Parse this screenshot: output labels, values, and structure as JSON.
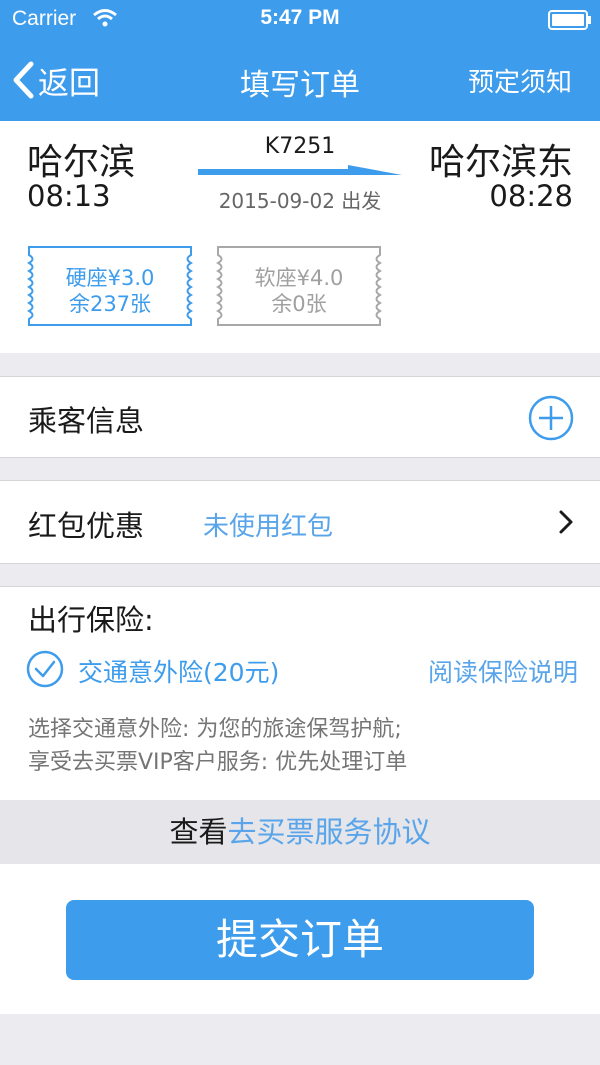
{
  "status_bar": {
    "carrier": "Carrier",
    "time": "5:47 PM"
  },
  "nav": {
    "back_label": "返回",
    "title": "填写订单",
    "right_label": "预定须知"
  },
  "train": {
    "from_station": "哈尔滨",
    "from_time": "08:13",
    "to_station": "哈尔滨东",
    "to_time": "08:28",
    "number": "K7251",
    "depart_text": "2015-09-02 出发"
  },
  "seats": [
    {
      "type": "硬座¥3.0",
      "remaining": "余237张",
      "selected": true
    },
    {
      "type": "软座¥4.0",
      "remaining": "余0张",
      "selected": false
    }
  ],
  "passenger": {
    "label": "乘客信息"
  },
  "coupon": {
    "label": "红包优惠",
    "value": "未使用红包"
  },
  "insurance": {
    "title": "出行保险:",
    "option": "交通意外险(20元)",
    "checked": true,
    "read_link": "阅读保险说明",
    "note1": "选择交通意外险: 为您的旅途保驾护航;",
    "note2": "享受去买票VIP客户服务:  优先处理订单"
  },
  "agreement": {
    "prefix": "查看",
    "link": "去买票服务协议"
  },
  "submit_label": "提交订单",
  "colors": {
    "accent": "#3d9cec",
    "link": "#5aa5ea",
    "background": "#ebebf0"
  }
}
